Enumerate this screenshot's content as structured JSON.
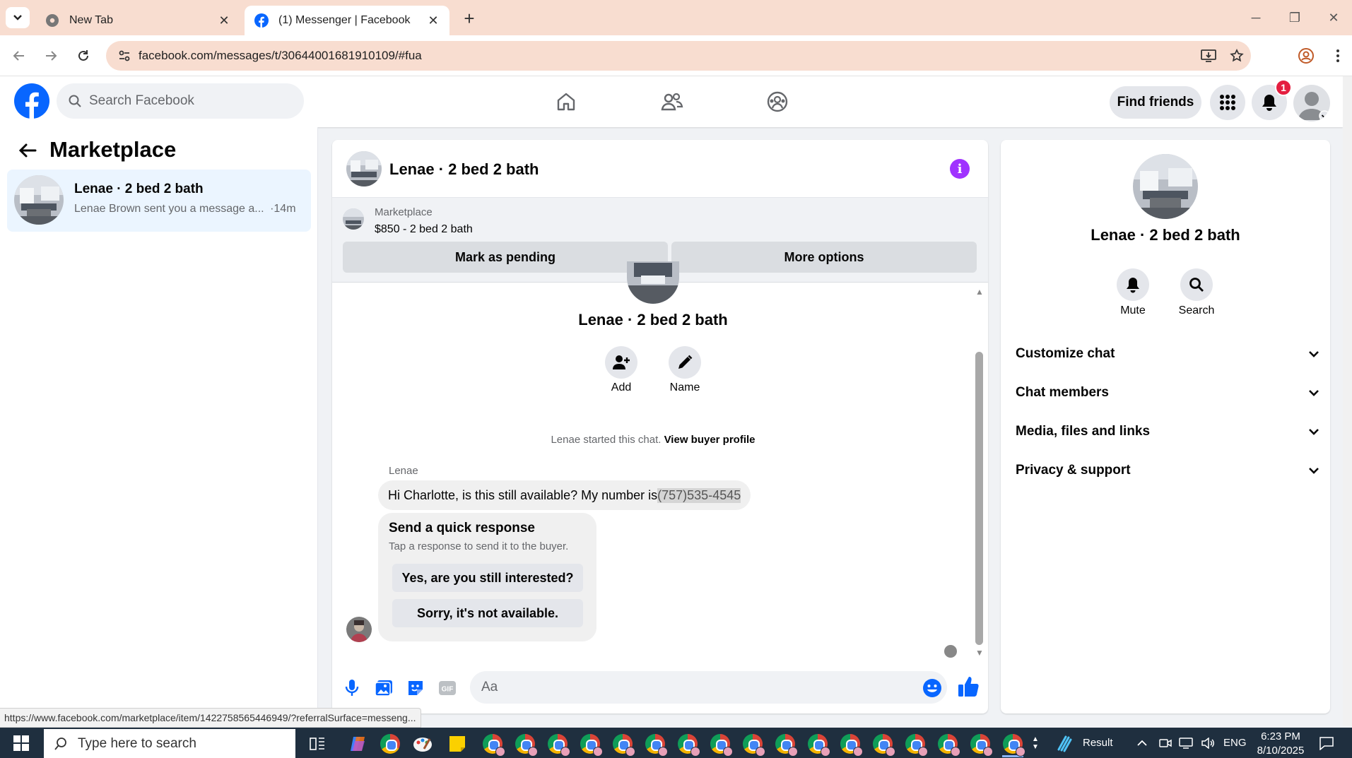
{
  "browser": {
    "tabs": [
      {
        "label": "New Tab",
        "active": false
      },
      {
        "label": "(1) Messenger | Facebook",
        "active": true
      }
    ],
    "url": "facebook.com/messages/t/30644001681910109/#fua",
    "status_url": "https://www.facebook.com/marketplace/item/1422758565446949/?referralSurface=messeng..."
  },
  "fb_header": {
    "search_placeholder": "Search Facebook",
    "find_friends": "Find friends",
    "notification_count": "1"
  },
  "sidebar": {
    "title": "Marketplace",
    "conversations": [
      {
        "name": "Lenae · 2 bed 2 bath",
        "preview": "Lenae Brown sent you a message a...",
        "time": "·14m"
      }
    ]
  },
  "chat": {
    "title": "Lenae · 2 bed 2 bath",
    "listing": {
      "source": "Marketplace",
      "title": "$850 - 2 bed 2 bath"
    },
    "buttons": {
      "pending": "Mark as pending",
      "more": "More options"
    },
    "profile_name": "Lenae · 2 bed 2 bath",
    "actions": [
      {
        "label": "Add"
      },
      {
        "label": "Name"
      }
    ],
    "started_text": "Lenae started this chat.",
    "view_profile": "View buyer profile",
    "sender": "Lenae",
    "message_text": "Hi Charlotte, is this still available? My number is ",
    "message_phone": "(757)535-4545",
    "quick_response": {
      "title": "Send a quick response",
      "subtitle": "Tap a response to send it to the buyer.",
      "options": [
        "Yes, are you still interested?",
        "Sorry, it's not available."
      ]
    },
    "input_placeholder": "Aa"
  },
  "right_panel": {
    "name": "Lenae · 2 bed 2 bath",
    "actions": [
      {
        "label": "Mute"
      },
      {
        "label": "Search"
      }
    ],
    "sections": [
      "Customize chat",
      "Chat members",
      "Media, files and links",
      "Privacy & support"
    ]
  },
  "taskbar": {
    "search_placeholder": "Type here to search",
    "weather": "Result",
    "language": "ENG",
    "time": "6:23 PM",
    "date": "8/10/2025"
  },
  "colors": {
    "fb_blue": "#0866ff",
    "messenger_purple": "#a033ff",
    "tab_bar": "#f8ddd0",
    "badge_red": "#e41e3f"
  }
}
